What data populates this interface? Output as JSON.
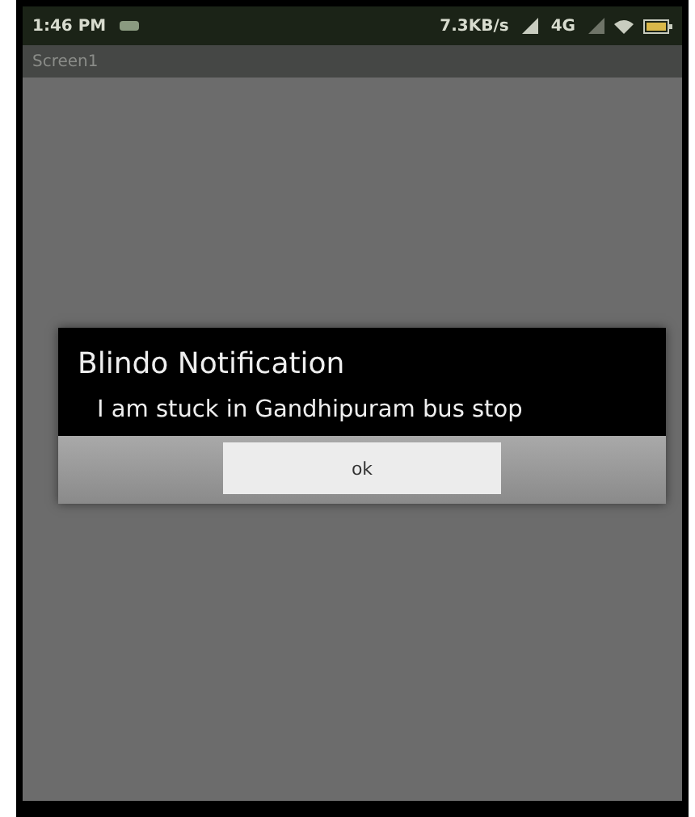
{
  "status_bar": {
    "time": "1:46 PM",
    "speed": "7.3KB/s",
    "network": "4G"
  },
  "app_bar": {
    "title": "Screen1"
  },
  "dialog": {
    "title": "Blindo Notification",
    "message": "I am stuck in Gandhipuram bus stop",
    "buttons": [
      "ok"
    ]
  }
}
